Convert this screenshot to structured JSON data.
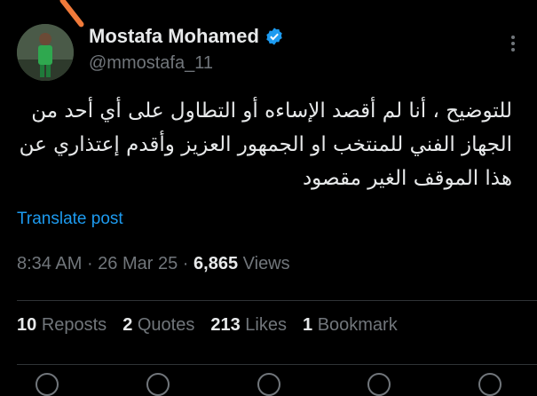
{
  "author": {
    "name": "Mostafa Mohamed",
    "handle": "@mmostafa_11"
  },
  "post": {
    "text": "للتوضيح ، أنا لم أقصد الإساءه أو التطاول على أي أحد من الجهاز الفني للمنتخب او الجمهور العزيز وأقدم إعتذاري عن هذا الموقف الغير مقصود",
    "translate_label": "Translate post"
  },
  "meta": {
    "time": "8:34 AM",
    "date": "26 Mar 25",
    "views_count": "6,865",
    "views_label": "Views"
  },
  "stats": {
    "reposts_count": "10",
    "reposts_label": "Reposts",
    "quotes_count": "2",
    "quotes_label": "Quotes",
    "likes_count": "213",
    "likes_label": "Likes",
    "bookmarks_count": "1",
    "bookmarks_label": "Bookmark"
  },
  "colors": {
    "background": "#000000",
    "text": "#e7e9ea",
    "muted": "#71767b",
    "link": "#1d9bf0",
    "verified": "#1d9bf0"
  }
}
